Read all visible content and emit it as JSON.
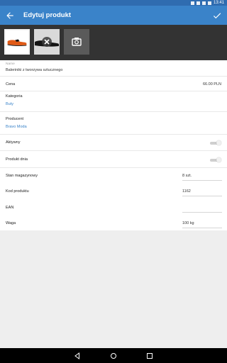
{
  "status_bar": {
    "time": "13:41"
  },
  "app_bar": {
    "title": "Edytuj produkt"
  },
  "images": {
    "count": 2
  },
  "form": {
    "name": {
      "label": "Name",
      "value": "Baleriniki z tworzywa sztucznego"
    },
    "price": {
      "label": "Cena",
      "value": "66.00 PLN"
    },
    "category": {
      "label": "Kategoria",
      "value": "Buty"
    },
    "producer": {
      "label": "Producent",
      "value": "Bravo Moda"
    },
    "active": {
      "label": "Aktywny",
      "checked": false
    },
    "product_of_day": {
      "label": "Produkt dnia",
      "checked": false
    },
    "stock": {
      "label": "Stan magazynowy",
      "value": "8 szt."
    },
    "product_code": {
      "label": "Kod produktu",
      "value": "1162"
    },
    "ean": {
      "label": "EAN",
      "value": ""
    },
    "weight": {
      "label": "Waga",
      "value": "100 kg"
    }
  },
  "colors": {
    "primary": "#3a83c9",
    "status": "#2f6cb0",
    "image_strip": "#333333"
  }
}
